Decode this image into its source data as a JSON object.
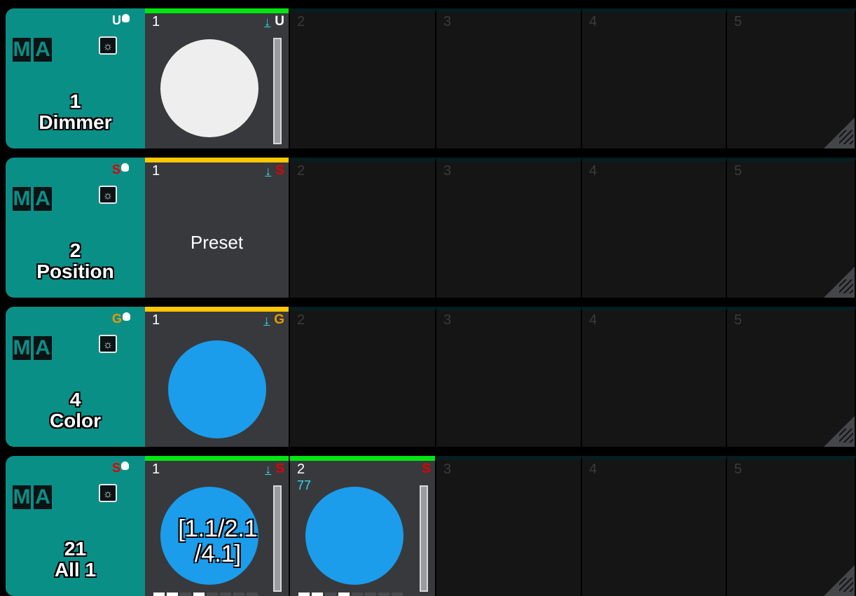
{
  "colors": {
    "teal": "#0a8f87",
    "green_bar": "#00e612",
    "yellow_bar": "#ffc800",
    "blue_fill": "#1b9deb",
    "white_fill": "#eeeeee",
    "cyan_text": "#34d9e6",
    "red_text": "#e60000",
    "gold_text": "#e69c00"
  },
  "pools": [
    {
      "logo_m": "M",
      "logo_a": "A",
      "badge_letter": "U",
      "badge_color": "#ffffff",
      "number": "1",
      "name": "Dimmer",
      "cells": [
        {
          "number": "1",
          "letter": "U",
          "letter_color": "#ffffff",
          "bar_color": "#00e612",
          "content": "white-circle"
        },
        {
          "number": "2"
        },
        {
          "number": "3"
        },
        {
          "number": "4"
        },
        {
          "number": "5"
        }
      ]
    },
    {
      "logo_m": "M",
      "logo_a": "A",
      "badge_letter": "S",
      "badge_color": "#e60000",
      "number": "2",
      "name": "Position",
      "cells": [
        {
          "number": "1",
          "letter": "S",
          "letter_color": "#e60000",
          "bar_color": "#ffc800",
          "label": "Preset"
        },
        {
          "number": "2"
        },
        {
          "number": "3"
        },
        {
          "number": "4"
        },
        {
          "number": "5"
        }
      ]
    },
    {
      "logo_m": "M",
      "logo_a": "A",
      "badge_letter": "G",
      "badge_color": "#e69c00",
      "number": "4",
      "name": "Color",
      "cells": [
        {
          "number": "1",
          "letter": "G",
          "letter_color": "#e69c00",
          "bar_color": "#ffc800",
          "content": "blue-circle"
        },
        {
          "number": "2"
        },
        {
          "number": "3"
        },
        {
          "number": "4"
        },
        {
          "number": "5"
        }
      ]
    },
    {
      "logo_m": "M",
      "logo_a": "A",
      "badge_letter": "S",
      "badge_color": "#e60000",
      "number": "21",
      "name": "All 1",
      "cells": [
        {
          "number": "1",
          "letter": "S",
          "letter_color": "#e60000",
          "bar_color": "#00e612",
          "content": "blue-circle",
          "overlay": "[1.1/2.1\n/4.1]"
        },
        {
          "number": "2",
          "letter": "S",
          "letter_color": "#e60000",
          "bar_color": "#00e612",
          "content": "blue-circle",
          "cue": "77"
        },
        {
          "number": "3"
        },
        {
          "number": "4"
        },
        {
          "number": "5"
        }
      ]
    }
  ]
}
